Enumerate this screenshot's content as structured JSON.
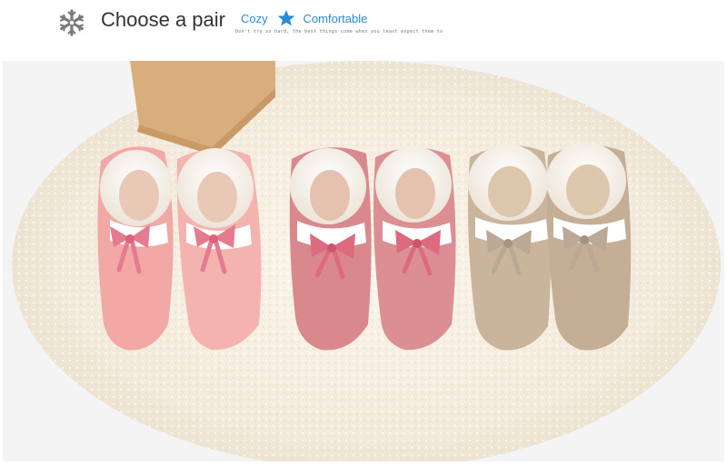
{
  "header": {
    "title": "Choose a pair",
    "tag_left": "Cozy",
    "tag_right": "Comfortable",
    "tagline": "Don't try so hard, the best things come when you least expect them to",
    "icon_left": "snowflake-icon",
    "icon_star": "star-icon",
    "accent_color": "#2a8bd9"
  },
  "photo": {
    "variants": [
      {
        "color_name": "light-pink",
        "hex": "#f0a9a6"
      },
      {
        "color_name": "rose-pink",
        "hex": "#d98a8e"
      },
      {
        "color_name": "khaki",
        "hex": "#c9b49c"
      }
    ]
  }
}
